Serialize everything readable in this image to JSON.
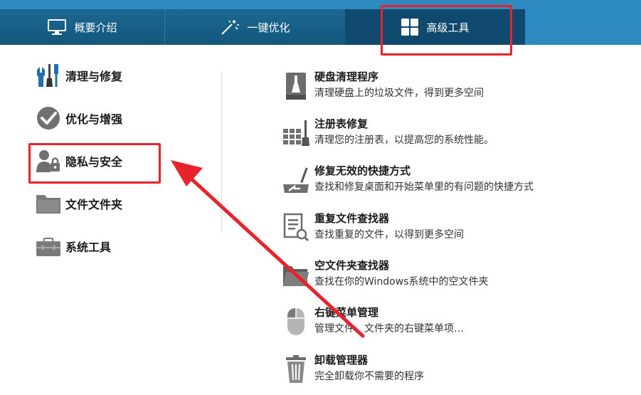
{
  "tabs": [
    {
      "label": "概要介绍",
      "icon": "monitor-icon"
    },
    {
      "label": "一键优化",
      "icon": "magic-wand-icon"
    },
    {
      "label": "高级工具",
      "icon": "grid-icon"
    }
  ],
  "sidebar": {
    "items": [
      {
        "label": "清理与修复",
        "icon": "repair-tools-icon"
      },
      {
        "label": "优化与增强",
        "icon": "checkmark-icon"
      },
      {
        "label": "隐私与安全",
        "icon": "user-lock-icon"
      },
      {
        "label": "文件文件夹",
        "icon": "folder-icon"
      },
      {
        "label": "系统工具",
        "icon": "toolbox-icon"
      }
    ]
  },
  "tools": [
    {
      "title": "硬盘清理程序",
      "desc": "清理硬盘上的垃圾文件，得到更多空间",
      "icon": "disk-cleanup-icon"
    },
    {
      "title": "注册表修复",
      "desc": "清理您的注册表，以提高您的系统性能。",
      "icon": "registry-repair-icon"
    },
    {
      "title": "修复无效的快捷方式",
      "desc": "查找和修复桌面和开始菜单里的有问题的快捷方式",
      "icon": "shortcut-repair-icon"
    },
    {
      "title": "重复文件查找器",
      "desc": "查找重复的文件，以得到更多空间",
      "icon": "duplicate-finder-icon"
    },
    {
      "title": "空文件夹查找器",
      "desc": "查找在你的Windows系统中的空文件夹",
      "icon": "empty-folder-icon"
    },
    {
      "title": "右键菜单管理",
      "desc": "管理文件、文件夹的右键菜单项…",
      "icon": "mouse-icon"
    },
    {
      "title": "卸载管理器",
      "desc": "完全卸载你不需要的程序",
      "icon": "trash-bin-icon"
    }
  ],
  "colors": {
    "tab_bar": "#14577c",
    "tab_active": "#0f4a6e",
    "annotation_red": "#e8232b",
    "icon_gray": "#6f6f6f",
    "icon_blue": "#1f6fb2"
  }
}
